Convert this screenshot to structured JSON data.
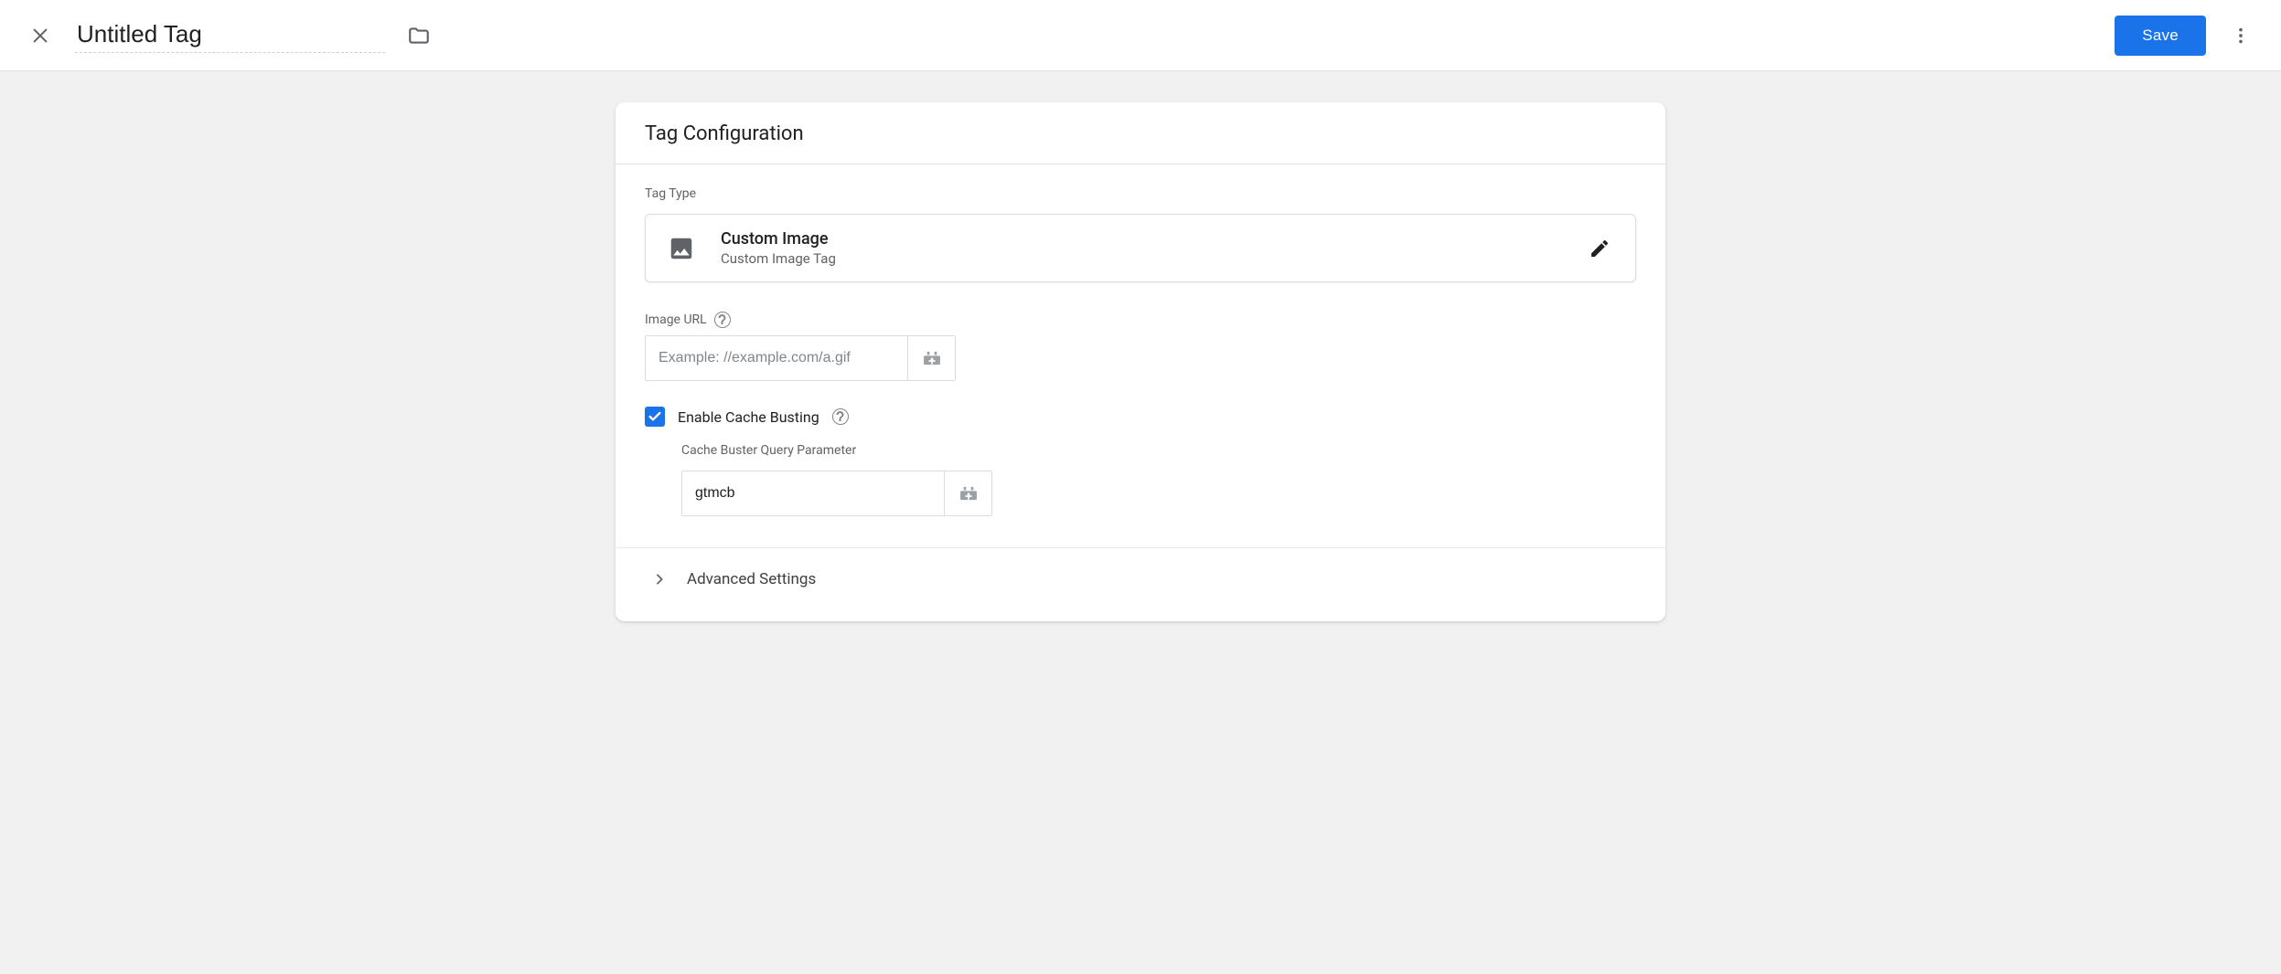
{
  "header": {
    "title": "Untitled Tag",
    "save_label": "Save"
  },
  "card": {
    "title": "Tag Configuration",
    "tag_type_label": "Tag Type",
    "tag_type": {
      "name": "Custom Image",
      "subtitle": "Custom Image Tag"
    },
    "image_url": {
      "label": "Image URL",
      "placeholder": "Example: //example.com/a.gif",
      "value": ""
    },
    "cache_busting": {
      "checkbox_label": "Enable Cache Busting",
      "checked": true,
      "param_label": "Cache Buster Query Parameter",
      "param_value": "gtmcb"
    },
    "advanced_label": "Advanced Settings"
  }
}
